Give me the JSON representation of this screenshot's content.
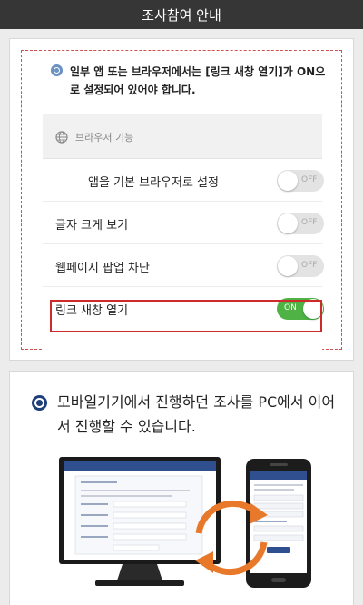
{
  "header": {
    "title": "조사참여 안내"
  },
  "notice": {
    "text": "일부 앱 또는 브라우저에서는 [링크 새창 열기]가 ON으로 설정되어 있어야 합니다."
  },
  "settings": {
    "section_title": "브라우저 기능",
    "items": [
      {
        "label": "앱을 기본 브라우저로 설정",
        "state": "OFF"
      },
      {
        "label": "글자 크게 보기",
        "state": "OFF"
      },
      {
        "label": "웹페이지 팝업 차단",
        "state": "OFF"
      },
      {
        "label": "링크 새창 열기",
        "state": "ON"
      }
    ]
  },
  "pc_section": {
    "text": "모바일기기에서 진행하던 조사를 PC에서 이어서 진행할 수 있습니다."
  },
  "colors": {
    "header_bg": "#363636",
    "toggle_on": "#4fb245",
    "highlight": "#cf2a2a",
    "radio_blue": "#6a91c2",
    "radio_navy": "#1f3f7a"
  }
}
